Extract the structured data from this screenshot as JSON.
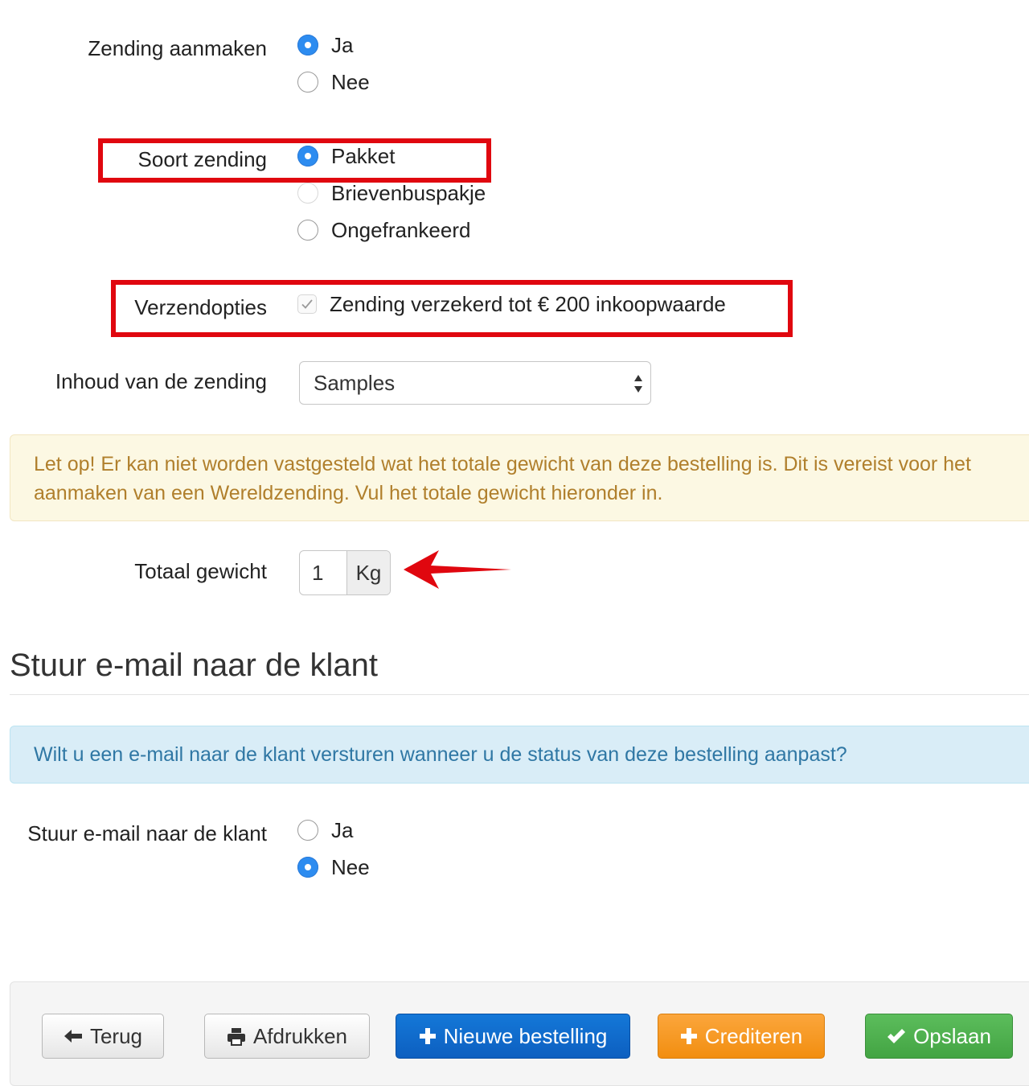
{
  "shipment": {
    "create": {
      "label": "Zending aanmaken",
      "options": [
        "Ja",
        "Nee"
      ],
      "selected": "Ja"
    },
    "type": {
      "label": "Soort zending",
      "options": [
        "Pakket",
        "Brievenbuspakje",
        "Ongefrankeerd"
      ],
      "selected": "Pakket"
    },
    "shipping_options": {
      "label": "Verzendopties",
      "insured_label": "Zending verzekerd tot € 200 inkoopwaarde",
      "insured_checked": true
    },
    "contents": {
      "label": "Inhoud van de zending",
      "selected": "Samples"
    },
    "warning": "Let op! Er kan niet worden vastgesteld wat het totale gewicht van deze bestelling is. Dit is vereist voor het aanmaken van een Wereldzending. Vul het totale gewicht hieronder in.",
    "weight": {
      "label": "Totaal gewicht",
      "value": "1",
      "unit": "Kg"
    }
  },
  "email": {
    "section_title": "Stuur e-mail naar de klant",
    "info": "Wilt u een e-mail naar de klant versturen wanneer u de status van deze bestelling aanpast?",
    "label": "Stuur e-mail naar de klant",
    "options": [
      "Ja",
      "Nee"
    ],
    "selected": "Nee"
  },
  "footer": {
    "back": "Terug",
    "print": "Afdrukken",
    "new_order": "Nieuwe bestelling",
    "credit": "Crediteren",
    "save": "Opslaan"
  },
  "colors": {
    "annotation_red": "#e0070f",
    "primary": "#0d5fc0",
    "warning": "#f28e10",
    "success": "#43a443",
    "radio_blue": "#2d8cf0"
  }
}
